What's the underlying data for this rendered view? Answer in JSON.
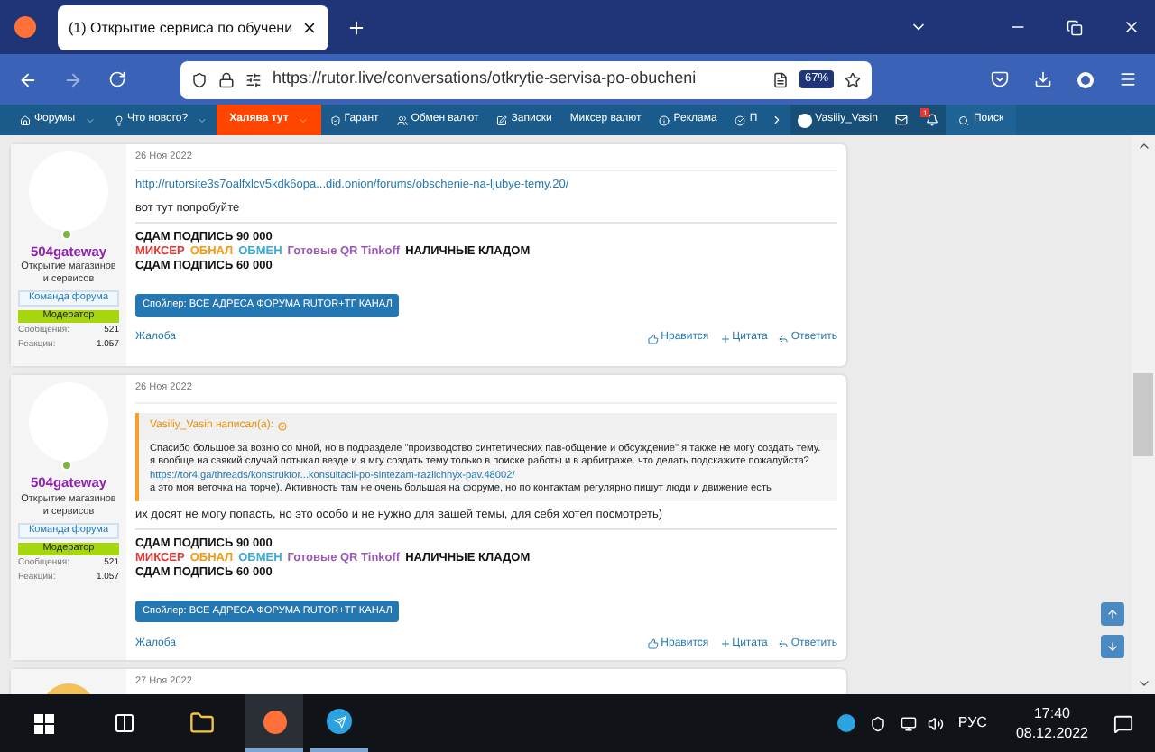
{
  "browser": {
    "tab_title": "(1) Открытие сервиса по обучени",
    "url": "https://rutor.live/conversations/otkrytie-servisa-po-obucheni",
    "zoom": "67%"
  },
  "nav": {
    "items": [
      {
        "label": "Форумы",
        "caret": true,
        "highlighted": false
      },
      {
        "label": "Что нового?",
        "caret": true,
        "highlighted": false
      },
      {
        "label": "Халява тут",
        "caret": true,
        "highlighted": true
      },
      {
        "label": "Гарант",
        "caret": false,
        "highlighted": false
      },
      {
        "label": "Обмен валют",
        "caret": false,
        "highlighted": false
      },
      {
        "label": "Записки",
        "caret": false,
        "highlighted": false
      },
      {
        "label": "Миксер валют",
        "caret": false,
        "highlighted": false
      },
      {
        "label": "Реклама",
        "caret": false,
        "highlighted": false
      },
      {
        "label": "П",
        "caret": false,
        "highlighted": false
      }
    ],
    "user": "Vasiliy_Vasin",
    "alerts": "1",
    "search": "Поиск"
  },
  "posts": [
    {
      "date": "26 Ноя 2022",
      "author": "504gateway",
      "user_title": "Открытие магазинов и сервисов",
      "group": "Команда форума",
      "role": "Модератор",
      "stats": [
        {
          "label": "Сообщения:",
          "value": "521"
        },
        {
          "label": "Реакции:",
          "value": "1.057"
        }
      ],
      "body": [
        {
          "kind": "link",
          "text": "http://rutorsite3s7oalfxlcv5kdk6opa...did.onion/forums/obschenie-na-ljubye-temy.20/"
        },
        {
          "kind": "text",
          "text": "вот тут попробуйте"
        }
      ],
      "signature": [
        [
          {
            "text": "СДАМ ПОДПИСЬ 90 000",
            "color": "#111111"
          }
        ],
        [
          {
            "text": "МИКСЕР",
            "color": "#e53935"
          },
          {
            "text": "ОБНАЛ",
            "color": "#f39c12"
          },
          {
            "text": "ОБМЕН",
            "color": "#3fa9d6"
          },
          {
            "text": "Готовые QR Tinkoff",
            "color": "#9b59b6"
          },
          {
            "text": "НАЛИЧНЫЕ КЛАДОМ",
            "color": "#111111"
          }
        ],
        [
          {
            "text": "СДАМ ПОДПИСЬ 60 000",
            "color": "#111111"
          }
        ]
      ],
      "spoiler": "Спойлер: ВСЕ АДРЕСА ФОРУМА RUTOR+ТГ КАНАЛ",
      "report": "Жалоба",
      "actions": [
        "Нравится",
        "Цитата",
        "Ответить"
      ]
    },
    {
      "date": "26 Ноя 2022",
      "author": "504gateway",
      "user_title": "Открытие магазинов и сервисов",
      "group": "Команда форума",
      "role": "Модератор",
      "stats": [
        {
          "label": "Сообщения:",
          "value": "521"
        },
        {
          "label": "Реакции:",
          "value": "1.057"
        }
      ],
      "quote": {
        "author": "Vasiliy_Vasin написал(а):",
        "body": [
          {
            "kind": "text",
            "text": "Спасибо большое за возню со мной, но в подразделе \"производство синтетических пав-общение и обсуждение\" я также не могу создать тему. я вообще на свякий случай потыкал везде и я мгу создать тему только в поиске работы и в арбитраже. что делать подскажите пожалуйста?"
          },
          {
            "kind": "link",
            "text": "https://tor4.ga/threads/konstruktor...konsultacii-po-sintezam-razlichnyx-pav.48002/"
          },
          {
            "kind": "text",
            "text": "а это моя веточка на торче). Активность там не очень большая на форуме, но по контактам регулярно пишут люди и движение есть"
          }
        ]
      },
      "body": [
        {
          "kind": "text",
          "text": "их досят не могу попасть, но это особо и не нужно для вашей темы, для себя хотел посмотреть)"
        }
      ],
      "signature": [
        [
          {
            "text": "СДАМ ПОДПИСЬ 90 000",
            "color": "#111111"
          }
        ],
        [
          {
            "text": "МИКСЕР",
            "color": "#e53935"
          },
          {
            "text": "ОБНАЛ",
            "color": "#f39c12"
          },
          {
            "text": "ОБМЕН",
            "color": "#3fa9d6"
          },
          {
            "text": "Готовые QR Tinkoff",
            "color": "#9b59b6"
          },
          {
            "text": "НАЛИЧНЫЕ КЛАДОМ",
            "color": "#111111"
          }
        ],
        [
          {
            "text": "СДАМ ПОДПИСЬ 60 000",
            "color": "#111111"
          }
        ]
      ],
      "spoiler": "Спойлер: ВСЕ АДРЕСА ФОРУМА RUTOR+ТГ КАНАЛ",
      "report": "Жалоба",
      "actions": [
        "Нравится",
        "Цитата",
        "Ответить"
      ]
    },
    {
      "date": "27 Ноя 2022"
    }
  ],
  "taskbar": {
    "language": "РУС",
    "time": "17:40",
    "date": "08.12.2022"
  }
}
